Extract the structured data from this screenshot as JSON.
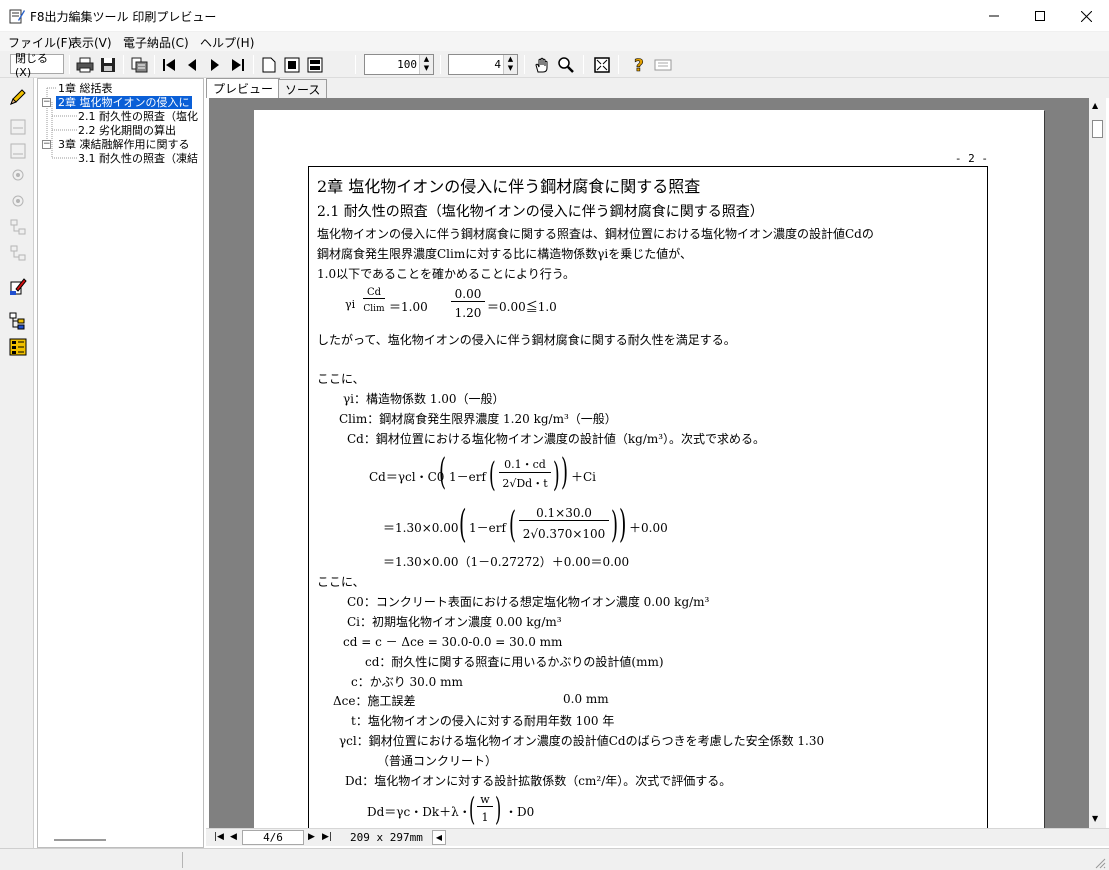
{
  "window": {
    "title": "F8出力編集ツール 印刷プレビュー"
  },
  "menu": [
    "ファイル(F)",
    "表示(V)",
    "電子納品(C)",
    "ヘルプ(H)"
  ],
  "toolbar": {
    "close_label": "閉じる(X)",
    "zoom_value": "100",
    "page_value": "4"
  },
  "tree": [
    {
      "label": "1章 総括表"
    },
    {
      "label": "2章 塩化物イオンの侵入に"
    },
    {
      "label": "2.1 耐久性の照査（塩化"
    },
    {
      "label": "2.2 劣化期間の算出"
    },
    {
      "label": "3章 凍結融解作用に関する"
    },
    {
      "label": "3.1 耐久性の照査（凍結"
    }
  ],
  "tabs": [
    "プレビュー",
    "ソース"
  ],
  "page": {
    "number": "- 2 -",
    "chapter_title": "2章 塩化物イオンの侵入に伴う鋼材腐食に関する照査",
    "section_title": "2.1 耐久性の照査（塩化物イオンの侵入に伴う鋼材腐食に関する照査）",
    "lines": [
      "塩化物イオンの侵入に伴う鋼材腐食に関する照査は、鋼材位置における塩化物イオン濃度の設計値Cdの",
      "鋼材腐食発生限界濃度Climに対する比に構造物係数γiを乗じた値が、",
      "1.0以下であることを確かめることにより行う。"
    ],
    "eq1": {
      "prefix": "γi",
      "num": "Cd",
      "den": "Clim",
      "mid": "＝1.00",
      "num2": "0.00",
      "den2": "1.20",
      "result": "＝0.00≦1.0"
    },
    "conclusion": "したがって、塩化物イオンの侵入に伴う鋼材腐食に関する耐久性を満足する。",
    "koko1": "ここに、",
    "defs1": [
      "γi：構造物係数 1.00（一般）",
      "Clim：鋼材腐食発生限界濃度 1.20 kg/m³（一般）",
      "Cd：鋼材位置における塩化物イオン濃度の設計値（kg/m³）。次式で求める。"
    ],
    "eq2": {
      "lhs": "Cd＝γcl・C0",
      "one_minus": "1－erf",
      "frac_num": "0.1・cd",
      "frac_den": "2√Dd・t",
      "tail": "＋Ci",
      "row2_lhs": "＝1.30×0.00",
      "row2_num": "0.1×30.0",
      "row2_den": "2√0.370×100",
      "row2_tail": "＋0.00",
      "row3": "＝1.30×0.00（1－0.27272）＋0.00＝0.00"
    },
    "koko2": "ここに、",
    "defs2": [
      "C0：コンクリート表面における想定塩化物イオン濃度 0.00 kg/m³",
      "Ci：初期塩化物イオン濃度 0.00 kg/m³",
      "cd = c － Δce = 30.0-0.0 = 30.0 mm",
      "cd：耐久性に関する照査に用いるかぶりの設計値(mm)",
      "c：かぶり 30.0 mm",
      "Δce：施工誤差",
      "0.0 mm",
      "t：塩化物イオンの侵入に対する耐用年数 100 年",
      "γcl：鋼材位置における塩化物イオン濃度の設計値Cdのばらつきを考慮した安全係数 1.30",
      "（普通コンクリート）",
      "Dd：塩化物イオンに対する設計拡散係数（cm²/年）。次式で評価する。"
    ],
    "eq3": {
      "lhs": "Dd＝γc・Dk＋λ・",
      "frac_num": "w",
      "frac_den": "1",
      "tail": "・D0"
    }
  },
  "status": {
    "page_indicator": "4/6",
    "paper_size": "209 x 297mm"
  }
}
